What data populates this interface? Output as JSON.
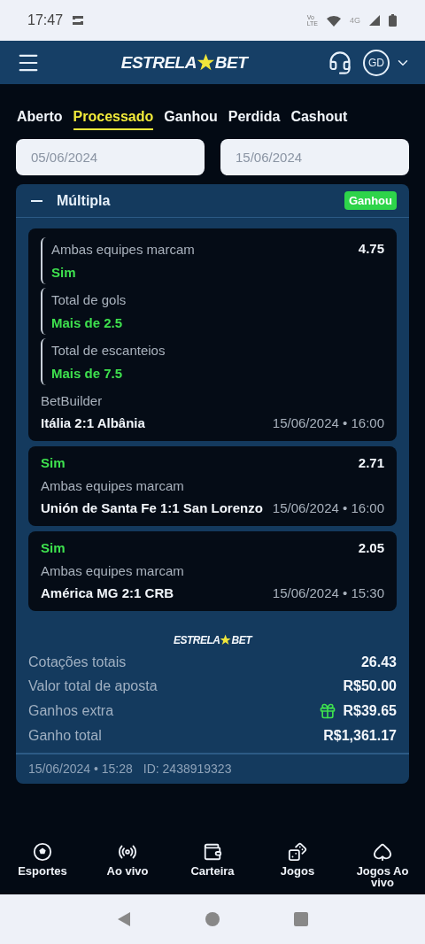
{
  "status_bar": {
    "time": "17:47",
    "volte_top": "Vo",
    "volte_bottom": "LTE",
    "network": "4G"
  },
  "header": {
    "logo": {
      "left": "ESTRELA",
      "right": "BET"
    },
    "avatar": "GD"
  },
  "tabs": [
    {
      "label": "Aberto",
      "selected": false
    },
    {
      "label": "Processado",
      "selected": true
    },
    {
      "label": "Ganhou",
      "selected": false
    },
    {
      "label": "Perdida",
      "selected": false
    },
    {
      "label": "Cashout",
      "selected": false
    }
  ],
  "date_from": {
    "placeholder": "05/06/2024"
  },
  "date_to": {
    "placeholder": "15/06/2024"
  },
  "bet": {
    "title": "Múltipla",
    "expanded": true,
    "status": "Ganhou",
    "selections": [
      {
        "kind": "builder",
        "odds": "4.75",
        "legs": [
          {
            "market": "Ambas equipes marcam",
            "pick": "Sim"
          },
          {
            "market": "Total de gols",
            "pick": "Mais de 2.5"
          },
          {
            "market": "Total de escanteios",
            "pick": "Mais de 7.5"
          }
        ],
        "label": "BetBuilder",
        "match": "Itália 2:1 Albânia",
        "datetime": "15/06/2024 • 16:00"
      },
      {
        "kind": "single",
        "pick": "Sim",
        "odds": "2.71",
        "market": "Ambas equipes marcam",
        "match": "Unión de Santa Fe 1:1 San Lorenzo",
        "datetime": "15/06/2024 • 16:00"
      },
      {
        "kind": "single",
        "pick": "Sim",
        "odds": "2.05",
        "market": "Ambas equipes marcam",
        "match": "América MG 2:1 CRB",
        "datetime": "15/06/2024 • 15:30"
      }
    ],
    "summary": {
      "logo": {
        "left": "ESTRELA",
        "right": "BET"
      },
      "rows": [
        {
          "label": "Cotações totais",
          "value": "26.43",
          "bonus": false
        },
        {
          "label": "Valor total de aposta",
          "value": "R$50.00",
          "bonus": false
        },
        {
          "label": "Ganhos extra",
          "value": "R$39.65",
          "bonus": true
        },
        {
          "label": "Ganho total",
          "value": "R$1,361.17",
          "bonus": false
        }
      ]
    },
    "footer": {
      "datetime": "15/06/2024 • 15:28",
      "id": "ID: 2438919323"
    }
  },
  "nav": [
    {
      "kind": "sports",
      "label": "Esportes"
    },
    {
      "kind": "live",
      "label": "Ao vivo"
    },
    {
      "kind": "wallet",
      "label": "Carteira"
    },
    {
      "kind": "games",
      "label": "Jogos"
    },
    {
      "kind": "livegames",
      "label": "Jogos Ao vivo"
    }
  ]
}
